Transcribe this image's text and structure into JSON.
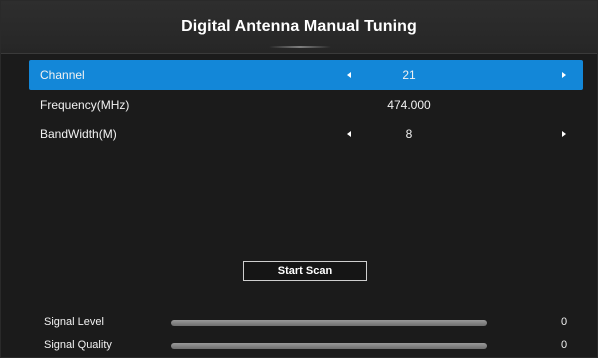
{
  "header": {
    "title": "Digital Antenna Manual Tuning"
  },
  "rows": [
    {
      "label": "Channel",
      "value": "21",
      "selected": true,
      "has_arrows": true
    },
    {
      "label": "Frequency(MHz)",
      "value": "474.000",
      "selected": false,
      "has_arrows": false
    },
    {
      "label": "BandWidth(M)",
      "value": "8",
      "selected": false,
      "has_arrows": true
    }
  ],
  "icons": {
    "arrow_left": "left-arrow-icon",
    "arrow_right": "right-arrow-icon"
  },
  "start_scan": {
    "label": "Start Scan"
  },
  "signal": {
    "level": {
      "label": "Signal Level",
      "value": "0",
      "fraction": 0
    },
    "quality": {
      "label": "Signal Quality",
      "value": "0",
      "fraction": 0
    }
  },
  "colors": {
    "accent": "#1387d8",
    "background": "#1b1b1b",
    "header": "#2b2b2b"
  }
}
